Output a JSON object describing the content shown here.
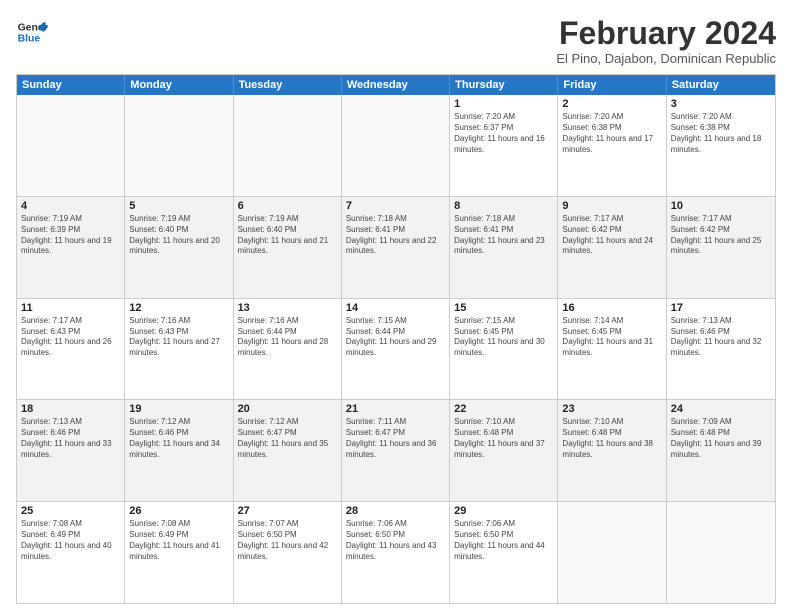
{
  "header": {
    "logo_line1": "General",
    "logo_line2": "Blue",
    "month_title": "February 2024",
    "subtitle": "El Pino, Dajabon, Dominican Republic"
  },
  "days_of_week": [
    "Sunday",
    "Monday",
    "Tuesday",
    "Wednesday",
    "Thursday",
    "Friday",
    "Saturday"
  ],
  "weeks": [
    [
      {
        "day": "",
        "empty": true
      },
      {
        "day": "",
        "empty": true
      },
      {
        "day": "",
        "empty": true
      },
      {
        "day": "",
        "empty": true
      },
      {
        "day": "1",
        "sunrise": "7:20 AM",
        "sunset": "6:37 PM",
        "daylight": "11 hours and 16 minutes."
      },
      {
        "day": "2",
        "sunrise": "7:20 AM",
        "sunset": "6:38 PM",
        "daylight": "11 hours and 17 minutes."
      },
      {
        "day": "3",
        "sunrise": "7:20 AM",
        "sunset": "6:38 PM",
        "daylight": "11 hours and 18 minutes."
      }
    ],
    [
      {
        "day": "4",
        "sunrise": "7:19 AM",
        "sunset": "6:39 PM",
        "daylight": "11 hours and 19 minutes."
      },
      {
        "day": "5",
        "sunrise": "7:19 AM",
        "sunset": "6:40 PM",
        "daylight": "11 hours and 20 minutes."
      },
      {
        "day": "6",
        "sunrise": "7:19 AM",
        "sunset": "6:40 PM",
        "daylight": "11 hours and 21 minutes."
      },
      {
        "day": "7",
        "sunrise": "7:18 AM",
        "sunset": "6:41 PM",
        "daylight": "11 hours and 22 minutes."
      },
      {
        "day": "8",
        "sunrise": "7:18 AM",
        "sunset": "6:41 PM",
        "daylight": "11 hours and 23 minutes."
      },
      {
        "day": "9",
        "sunrise": "7:17 AM",
        "sunset": "6:42 PM",
        "daylight": "11 hours and 24 minutes."
      },
      {
        "day": "10",
        "sunrise": "7:17 AM",
        "sunset": "6:42 PM",
        "daylight": "11 hours and 25 minutes."
      }
    ],
    [
      {
        "day": "11",
        "sunrise": "7:17 AM",
        "sunset": "6:43 PM",
        "daylight": "11 hours and 26 minutes."
      },
      {
        "day": "12",
        "sunrise": "7:16 AM",
        "sunset": "6:43 PM",
        "daylight": "11 hours and 27 minutes."
      },
      {
        "day": "13",
        "sunrise": "7:16 AM",
        "sunset": "6:44 PM",
        "daylight": "11 hours and 28 minutes."
      },
      {
        "day": "14",
        "sunrise": "7:15 AM",
        "sunset": "6:44 PM",
        "daylight": "11 hours and 29 minutes."
      },
      {
        "day": "15",
        "sunrise": "7:15 AM",
        "sunset": "6:45 PM",
        "daylight": "11 hours and 30 minutes."
      },
      {
        "day": "16",
        "sunrise": "7:14 AM",
        "sunset": "6:45 PM",
        "daylight": "11 hours and 31 minutes."
      },
      {
        "day": "17",
        "sunrise": "7:13 AM",
        "sunset": "6:46 PM",
        "daylight": "11 hours and 32 minutes."
      }
    ],
    [
      {
        "day": "18",
        "sunrise": "7:13 AM",
        "sunset": "6:46 PM",
        "daylight": "11 hours and 33 minutes."
      },
      {
        "day": "19",
        "sunrise": "7:12 AM",
        "sunset": "6:46 PM",
        "daylight": "11 hours and 34 minutes."
      },
      {
        "day": "20",
        "sunrise": "7:12 AM",
        "sunset": "6:47 PM",
        "daylight": "11 hours and 35 minutes."
      },
      {
        "day": "21",
        "sunrise": "7:11 AM",
        "sunset": "6:47 PM",
        "daylight": "11 hours and 36 minutes."
      },
      {
        "day": "22",
        "sunrise": "7:10 AM",
        "sunset": "6:48 PM",
        "daylight": "11 hours and 37 minutes."
      },
      {
        "day": "23",
        "sunrise": "7:10 AM",
        "sunset": "6:48 PM",
        "daylight": "11 hours and 38 minutes."
      },
      {
        "day": "24",
        "sunrise": "7:09 AM",
        "sunset": "6:48 PM",
        "daylight": "11 hours and 39 minutes."
      }
    ],
    [
      {
        "day": "25",
        "sunrise": "7:08 AM",
        "sunset": "6:49 PM",
        "daylight": "11 hours and 40 minutes."
      },
      {
        "day": "26",
        "sunrise": "7:08 AM",
        "sunset": "6:49 PM",
        "daylight": "11 hours and 41 minutes."
      },
      {
        "day": "27",
        "sunrise": "7:07 AM",
        "sunset": "6:50 PM",
        "daylight": "11 hours and 42 minutes."
      },
      {
        "day": "28",
        "sunrise": "7:06 AM",
        "sunset": "6:50 PM",
        "daylight": "11 hours and 43 minutes."
      },
      {
        "day": "29",
        "sunrise": "7:06 AM",
        "sunset": "6:50 PM",
        "daylight": "11 hours and 44 minutes."
      },
      {
        "day": "",
        "empty": true
      },
      {
        "day": "",
        "empty": true
      }
    ]
  ]
}
